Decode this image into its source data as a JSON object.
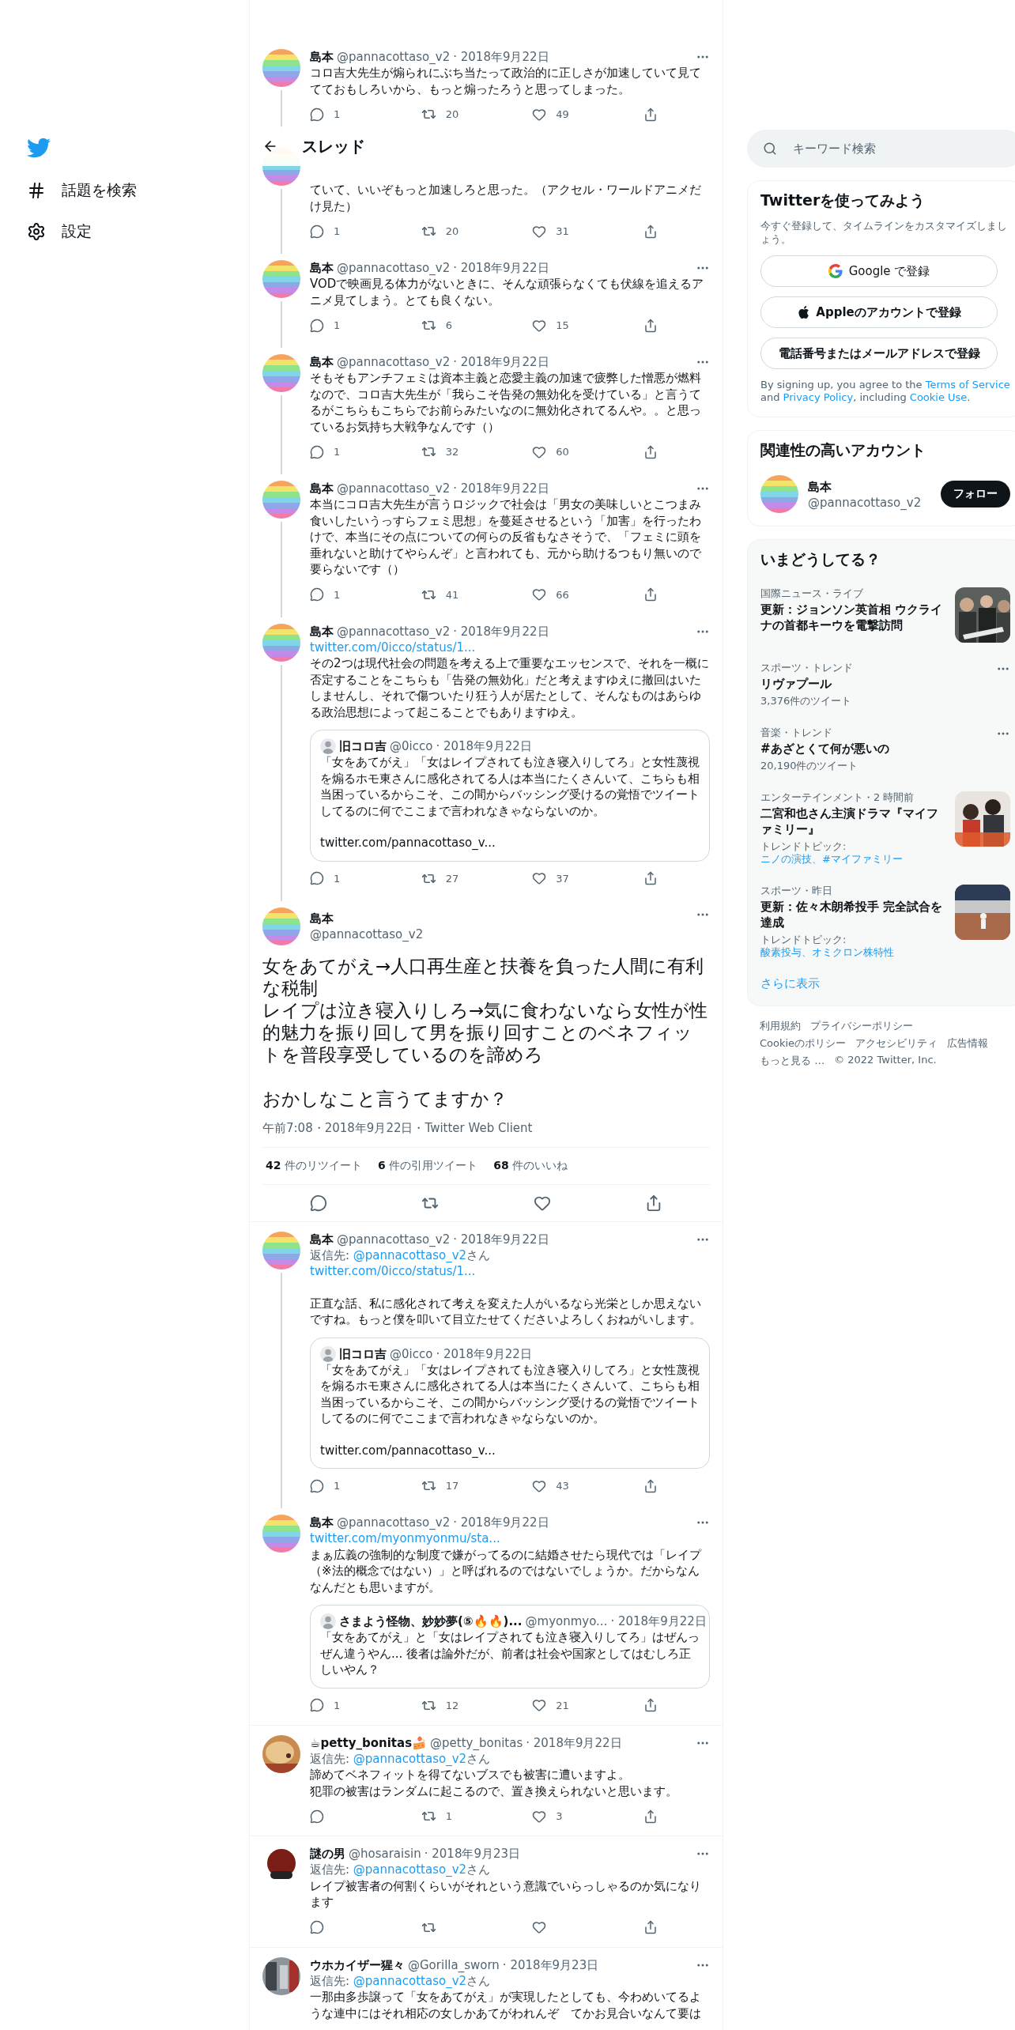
{
  "separator": "·",
  "nav": {
    "items": [
      {
        "kind": "explore",
        "label": "話題を検索"
      },
      {
        "kind": "settings",
        "label": "設定"
      }
    ]
  },
  "header": {
    "title": "スレッド"
  },
  "thread": [
    {
      "avatar": {
        "kind": "rainbow"
      },
      "name": "島本",
      "handle": "@pannacottaso_v2",
      "date": "2018年9月22日",
      "text": "コロ吉大先生が煽られにぶち当たって政治的に正しさが加速していて見ててておもしろいから、もっと煽ったろうと思ってしまった。",
      "thread_line": true,
      "has_actions": true,
      "replies": "1",
      "retweets": "20",
      "likes": "49"
    },
    {
      "avatar": {
        "kind": "rainbow"
      },
      "text": "ていて、いいぞもっと加速しろと思った。（アクセル・ワールドアニメだけ見た）",
      "thread_line": true,
      "has_actions": true,
      "replies": "1",
      "retweets": "20",
      "likes": "31"
    },
    {
      "avatar": {
        "kind": "rainbow"
      },
      "name": "島本",
      "handle": "@pannacottaso_v2",
      "date": "2018年9月22日",
      "text": "VODで映画見る体力がないときに、そんな頑張らなくても伏線を追えるアニメ見てしまう。とても良くない。",
      "thread_line": true,
      "has_actions": true,
      "replies": "1",
      "retweets": "6",
      "likes": "15"
    },
    {
      "avatar": {
        "kind": "rainbow"
      },
      "name": "島本",
      "handle": "@pannacottaso_v2",
      "date": "2018年9月22日",
      "text": "そもそもアンチフェミは資本主義と恋愛主義の加速で疲弊した憎悪が燃料なので、コロ吉大先生が「我らこそ告発の無効化を受けている」と言うてるがこちらもこちらでお前らみたいなのに無効化されてるんや。。と思っているお気持ち大戦争なんです（）",
      "thread_line": true,
      "has_actions": true,
      "replies": "1",
      "retweets": "32",
      "likes": "60"
    },
    {
      "avatar": {
        "kind": "rainbow"
      },
      "name": "島本",
      "handle": "@pannacottaso_v2",
      "date": "2018年9月22日",
      "text": "本当にコロ吉大先生が言うロジックで社会は「男女の美味しいとこつまみ食いしたいうっすらフェミ思想」を蔓延させるという「加害」を行ったわけで、本当にその点についての何らの反省もなさそうで、「フェミに頭を垂れないと助けてやらんぞ」と言われても、元から助けるつもり無いので要らないです（）",
      "thread_line": true,
      "has_actions": true,
      "replies": "1",
      "retweets": "41",
      "likes": "66"
    },
    {
      "avatar": {
        "kind": "rainbow"
      },
      "name": "島本",
      "handle": "@pannacottaso_v2",
      "date": "2018年9月22日",
      "link": "twitter.com/0icco/status/1...",
      "text": "その2つは現代社会の問題を考える上で重要なエッセンスで、それを一概に否定することをこちらも「告発の無効化」だと考えますゆえに撤回はいたしませんし、それで傷ついたり狂う人が居たとして、そんなものはあらゆる政治思想によって起こることでもありますゆえ。",
      "quote": {
        "avatar": {
          "kind": "figure"
        },
        "name": "旧コロ吉",
        "handle": "@0icco",
        "date": "2018年9月22日",
        "text": "「女をあてがえ」「女はレイプされても泣き寝入りしてろ」と女性蔑視を煽るホモ東さんに感化されてる人は本当にたくさんいて、こちらも相当困っているからこそ、この間からバッシング受けるの覚悟でツイートしてるのに何でここまで言われなきゃならないのか。",
        "link": "twitter.com/pannacottaso_v..."
      },
      "thread_line": true,
      "has_actions": true,
      "replies": "1",
      "retweets": "27",
      "likes": "37"
    }
  ],
  "main_tweet": {
    "avatar": {
      "kind": "rainbow"
    },
    "name": "島本",
    "handle": "@pannacottaso_v2",
    "paragraphs": [
      [
        "女をあてがえ→人口再生産と扶養を負った人間に有利な税制",
        "レイプは泣き寝入りしろ→気に食わないなら女性が性的魅力を振り回して男を振り回すことのベネフィットを普段享受しているのを諦めろ"
      ],
      [
        "おかしなこと言うてますか？"
      ]
    ],
    "meta": "午前7:08・2018年9月22日・Twitter Web Client",
    "stats": [
      {
        "count": "42",
        "label": "件のリツイート"
      },
      {
        "count": "6",
        "label": "件の引用ツイート"
      },
      {
        "count": "68",
        "label": "件のいいね"
      }
    ]
  },
  "replies": [
    {
      "avatar": {
        "kind": "rainbow"
      },
      "name": "島本",
      "handle": "@pannacottaso_v2",
      "date": "2018年9月22日",
      "reply_to": {
        "prefix": "返信先:",
        "user": "@pannacottaso_v2",
        "suffix": "さん"
      },
      "link": "twitter.com/0icco/status/1...",
      "text_gap": true,
      "text": "正直な話、私に感化されて考えを変えた人がいるなら光栄としか思えないですね。もっと僕を叩いて目立たせてくださいよろしくおねがいします。",
      "quote": {
        "avatar": {
          "kind": "figure"
        },
        "name": "旧コロ吉",
        "handle": "@0icco",
        "date": "2018年9月22日",
        "text": "「女をあてがえ」「女はレイプされても泣き寝入りしてろ」と女性蔑視を煽るホモ東さんに感化されてる人は本当にたくさんいて、こちらも相当困っているからこそ、この間からバッシング受けるの覚悟でツイートしてるのに何でここまで言われなきゃならないのか。",
        "link": "twitter.com/pannacottaso_v..."
      },
      "thread_line": true,
      "has_actions": true,
      "replies": "1",
      "retweets": "17",
      "likes": "43"
    },
    {
      "avatar": {
        "kind": "rainbow"
      },
      "name": "島本",
      "handle": "@pannacottaso_v2",
      "date": "2018年9月22日",
      "link": "twitter.com/myonmyonmu/sta...",
      "text": "まぁ広義の強制的な制度で嫌がってるのに結婚させたら現代では「レイプ（※法的概念ではない）」と呼ばれるのではないでしょうか。だからなんなんだとも思いますが。",
      "quote": {
        "avatar": {
          "kind": "figure"
        },
        "name": "さまよう怪物、妙妙夢(⑤🔥🔥)...",
        "handle": "@myonmyo...",
        "date": "2018年9月22日",
        "text": "「女をあてがえ」と「女はレイプされても泣き寝入りしてろ」はぜんっぜん違うやん... 後者は論外だが、前者は社会や国家としてはむしろ正しいやん？"
      },
      "thread_line": false,
      "has_actions": true,
      "replies": "1",
      "retweets": "12",
      "likes": "21"
    },
    {
      "avatar": {
        "kind": "food"
      },
      "name": "☕petty_bonitas🍰",
      "handle": "@petty_bonitas",
      "date": "2018年9月22日",
      "reply_to": {
        "prefix": "返信先:",
        "user": "@pannacottaso_v2",
        "suffix": "さん"
      },
      "lines": [
        "諦めてベネフィットを得てないブスでも被害に遭いますよ。",
        "犯罪の被害はランダムに起こるので、置き換えられないと思います。"
      ],
      "thread_line": false,
      "has_actions": true,
      "retweets": "1",
      "likes": "3"
    },
    {
      "avatar": {
        "kind": "mascot"
      },
      "name": "謎の男",
      "handle": "@hosaraisin",
      "date": "2018年9月23日",
      "reply_to": {
        "prefix": "返信先:",
        "user": "@pannacottaso_v2",
        "suffix": "さん"
      },
      "text": "レイプ被害者の何割くらいがそれという意識でいらっしゃるのか気になります",
      "thread_line": false,
      "has_actions": true
    },
    {
      "avatar": {
        "kind": "collage"
      },
      "name": "ウホカイザー猩々",
      "handle": "@Gorilla_sworn",
      "date": "2018年9月23日",
      "reply_to": {
        "prefix": "返信先:",
        "user": "@pannacottaso_v2",
        "suffix": "さん"
      },
      "text": "一那由多歩譲って「女をあてがえ」が実現したとしても、今わめいてるような連中にはそれ相応の女しかあてがわれんぞ　てかお見合いなんて要は",
      "thread_line": false,
      "has_actions": false
    }
  ],
  "search": {
    "placeholder": "キーワード検索"
  },
  "signup": {
    "title": "Twitterを使ってみよう",
    "subtitle": "今すぐ登録して、タイムラインをカスタマイズしましょう。",
    "buttons": [
      {
        "kind": "google",
        "label": "Google で登録"
      },
      {
        "kind": "apple",
        "label": "Appleのアカウントで登録"
      },
      {
        "kind": "plain",
        "label": "電話番号またはメールアドレスで登録"
      }
    ],
    "disclaimer": [
      {
        "text": "By signing up, you agree to the "
      },
      {
        "text": "Terms of Service",
        "link": true
      },
      {
        "text": " and "
      },
      {
        "text": "Privacy Policy",
        "link": true
      },
      {
        "text": ", including "
      },
      {
        "text": "Cookie Use",
        "link": true
      },
      {
        "text": "."
      }
    ]
  },
  "related": {
    "title": "関連性の高いアカウント",
    "account": {
      "avatar": {
        "kind": "rainbow"
      },
      "name": "島本",
      "handle": "@pannacottaso_v2",
      "button": "フォロー"
    }
  },
  "trends": {
    "title": "いまどうしてる？",
    "items": [
      {
        "category": "国際ニュース・ライブ",
        "title": "更新：ジョンソン英首相 ウクライナの首都キーウを電撃訪問",
        "picture": {
          "kind": "crowd"
        }
      },
      {
        "category": "スポーツ・トレンド",
        "title": "リヴァプール",
        "count": "3,376件のツイート",
        "more": true
      },
      {
        "category": "音楽・トレンド",
        "title": "#あざとくて何が悪いの",
        "count": "20,190件のツイート",
        "more": true
      },
      {
        "category": "エンターテインメント・2 時間前",
        "title": "二宮和也さん主演ドラマ『マイファミリー』",
        "topics": [
          {
            "text": "トレンドトピック: "
          },
          {
            "text": "ニノの演技、#マイファミリー",
            "link": true
          }
        ],
        "picture": {
          "kind": "poster"
        }
      },
      {
        "category": "スポーツ・昨日",
        "title": "更新：佐々木朗希投手 完全試合を達成",
        "topics": [
          {
            "text": "トレンドトピック: "
          },
          {
            "text": "酸素投与、オミクロン株特性",
            "link": true
          }
        ],
        "picture": {
          "kind": "stadium"
        }
      }
    ],
    "show_more": "さらに表示"
  },
  "footer": [
    "利用規約",
    "プライバシーポリシー",
    "Cookieのポリシー",
    "アクセシビリティ",
    "広告情報",
    "もっと見る …",
    "© 2022 Twitter, Inc."
  ]
}
